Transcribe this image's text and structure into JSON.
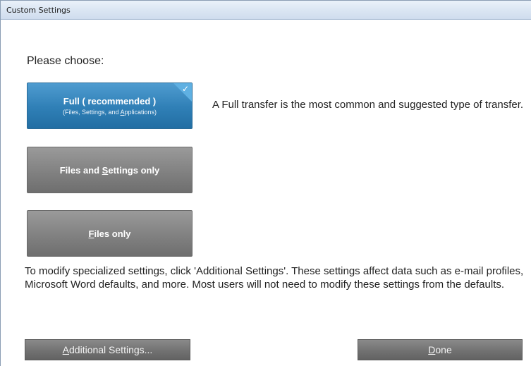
{
  "window": {
    "title": "Custom Settings"
  },
  "prompt": "Please choose:",
  "options": [
    {
      "main_parts": [
        "Full ( recommended )"
      ],
      "sub_parts": [
        "(Files, Settings, and ",
        "A",
        "pplications)"
      ],
      "selected": true,
      "check": "✓"
    },
    {
      "main_parts": [
        "Files and ",
        "S",
        "ettings only"
      ],
      "selected": false
    },
    {
      "main_parts": [
        "",
        "F",
        "iles only"
      ],
      "selected": false
    }
  ],
  "selected_description": "A Full transfer is the most common and suggested type of transfer.",
  "info_text": "To modify specialized settings, click 'Additional Settings'. These settings affect data such as e-mail profiles, Microsoft Word defaults, and more. Most users will not need to modify these settings from the defaults.",
  "buttons": {
    "additional_parts": [
      "",
      "A",
      "dditional Settings..."
    ],
    "done_parts": [
      "",
      "D",
      "one"
    ]
  },
  "colors": {
    "selected_option": "#2f7fb6",
    "option": "#818181",
    "button": "#727272"
  }
}
